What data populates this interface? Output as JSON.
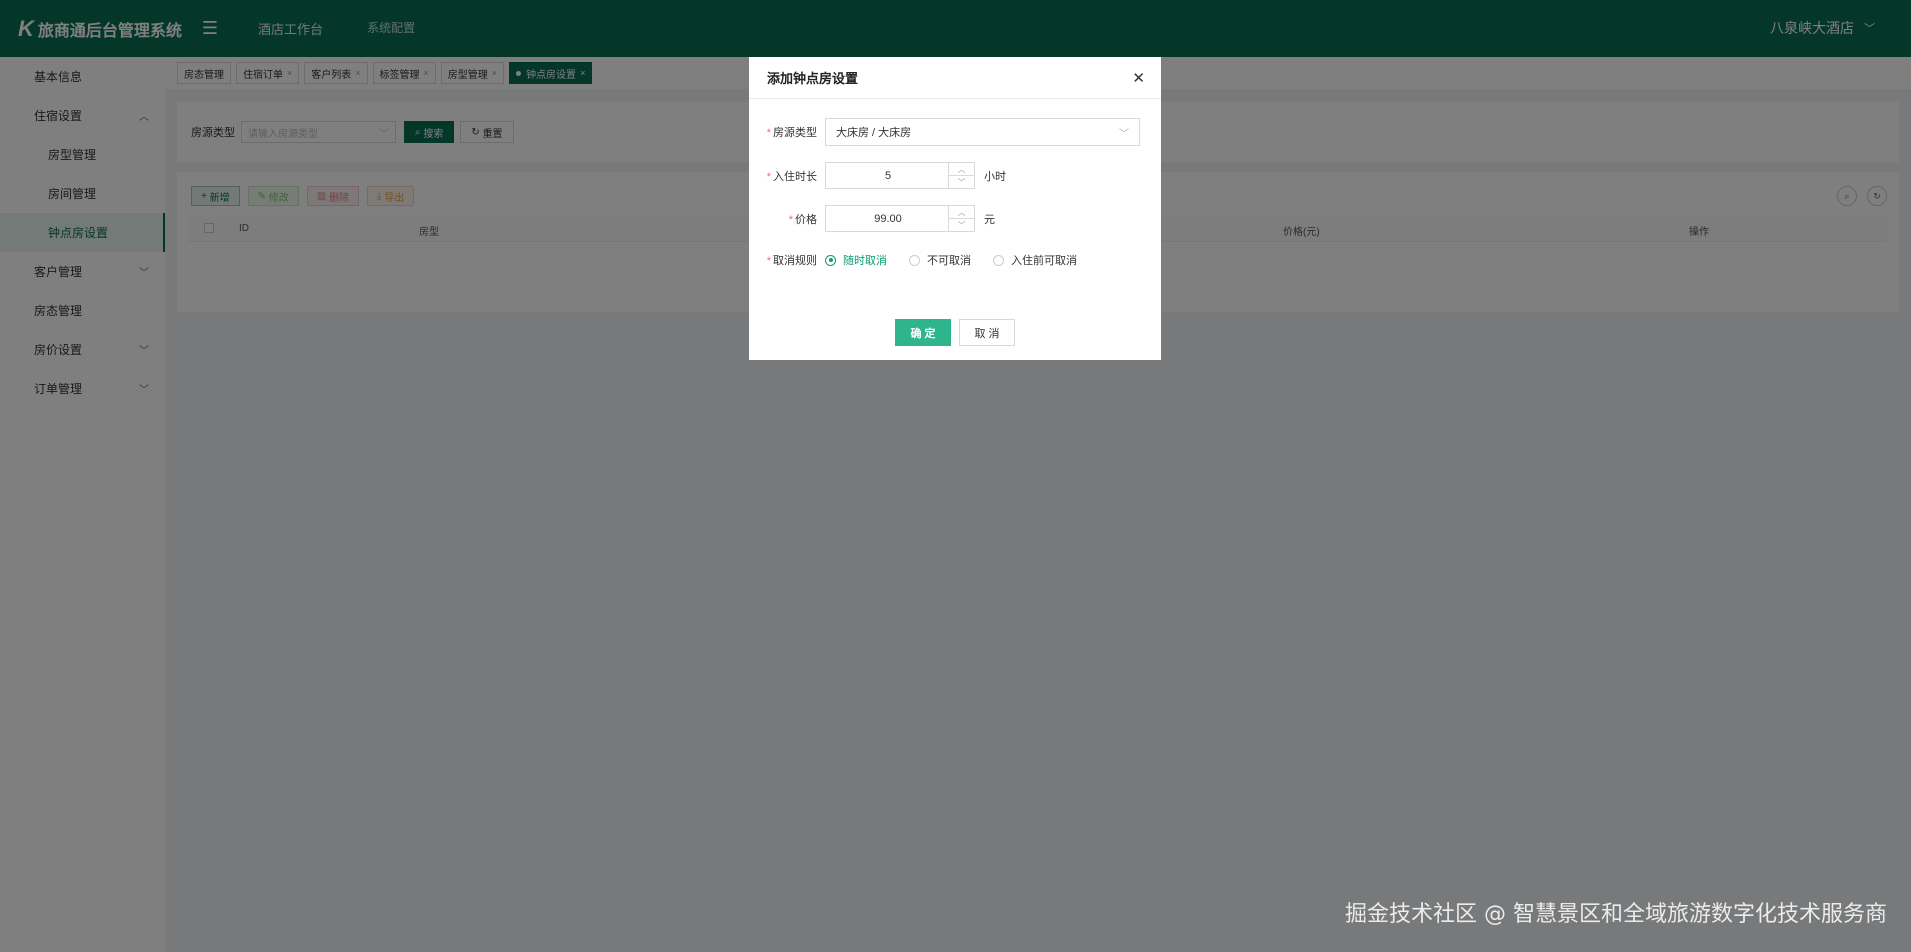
{
  "header": {
    "logo_mark": "K",
    "title": "旅商通后台管理系统",
    "nav": [
      "酒店工作台",
      "系统配置"
    ],
    "hotel": "八泉峡大酒店"
  },
  "sidebar": {
    "items": [
      {
        "label": "基本信息"
      },
      {
        "label": "住宿设置"
      },
      {
        "label": "房型管理"
      },
      {
        "label": "房间管理"
      },
      {
        "label": "钟点房设置"
      },
      {
        "label": "客户管理"
      },
      {
        "label": "房态管理"
      },
      {
        "label": "房价设置"
      },
      {
        "label": "订单管理"
      }
    ]
  },
  "tabs": [
    "房态管理",
    "住宿订单",
    "客户列表",
    "标签管理",
    "房型管理",
    "钟点房设置"
  ],
  "search": {
    "label": "房源类型",
    "placeholder": "请输入房源类型",
    "search_btn": "搜索",
    "reset_btn": "重置"
  },
  "toolbar": {
    "add": "新增",
    "edit": "修改",
    "delete": "删除",
    "export": "导出"
  },
  "table": {
    "columns": [
      "ID",
      "房型",
      "价格(元)",
      "操作"
    ]
  },
  "modal": {
    "title": "添加钟点房设置",
    "room_type_label": "房源类型",
    "room_type_value": "大床房 / 大床房",
    "duration_label": "入住时长",
    "duration_value": "5",
    "duration_unit": "小时",
    "price_label": "价格",
    "price_value": "99.00",
    "price_unit": "元",
    "cancel_rule_label": "取消规则",
    "cancel_options": [
      "随时取消",
      "不可取消",
      "入住前可取消"
    ],
    "confirm_btn": "确 定",
    "cancel_btn": "取 消"
  },
  "watermark": "掘金技术社区 @ 智慧景区和全域旅游数字化技术服务商",
  "colors": {
    "brand": "#0b6e53",
    "accent": "#2fb58b"
  }
}
